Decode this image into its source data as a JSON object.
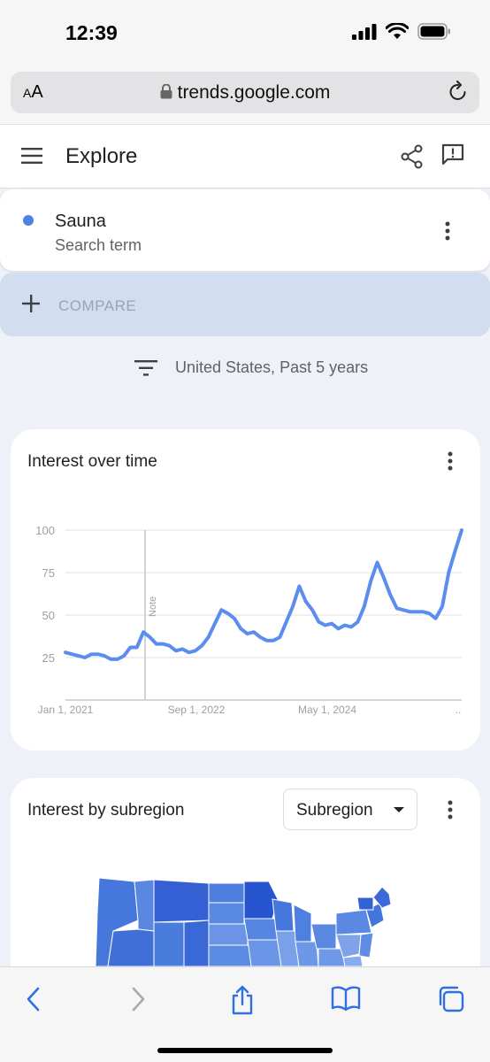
{
  "status": {
    "time": "12:39"
  },
  "browser": {
    "aa_small": "A",
    "aa_big": "A",
    "url": "trends.google.com"
  },
  "appbar": {
    "title": "Explore"
  },
  "term": {
    "name": "Sauna",
    "type": "Search term",
    "color": "#4e83e2"
  },
  "compare": {
    "label": "COMPARE"
  },
  "filter": {
    "text": "United States, Past 5 years"
  },
  "interest_over_time": {
    "title": "Interest over time",
    "note_label": "Note"
  },
  "subregion": {
    "title": "Interest by subregion",
    "select_value": "Subregion"
  },
  "chart_data": {
    "type": "line",
    "title": "Interest over time",
    "xlabel": "",
    "ylabel": "",
    "ylim": [
      0,
      100
    ],
    "yticks": [
      25,
      50,
      75,
      100
    ],
    "xticks": [
      "Jan 1, 2021",
      "Sep 1, 2022",
      "May 1, 2024",
      ".."
    ],
    "grid": true,
    "series": [
      {
        "color": "#5b8def",
        "values": [
          28,
          27,
          26,
          25,
          27,
          27,
          26,
          24,
          24,
          26,
          31,
          31,
          40,
          37,
          33,
          33,
          32,
          29,
          30,
          28,
          29,
          32,
          37,
          45,
          53,
          51,
          48,
          42,
          39,
          40,
          37,
          35,
          35,
          37,
          46,
          55,
          67,
          58,
          53,
          46,
          44,
          45,
          42,
          44,
          43,
          46,
          55,
          70,
          81,
          72,
          62,
          54,
          53,
          52,
          52,
          52,
          51,
          48,
          55,
          75,
          88,
          100
        ]
      }
    ]
  }
}
